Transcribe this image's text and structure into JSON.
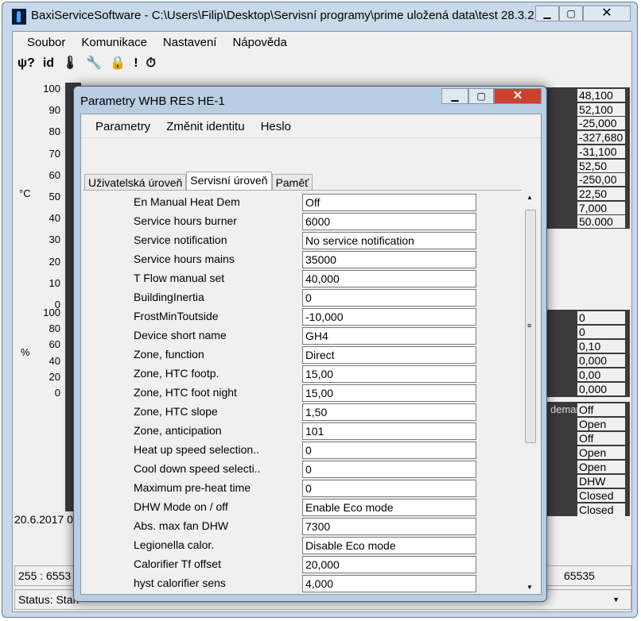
{
  "main": {
    "title": "BaxiServiceSoftware - C:\\Users\\Filip\\Desktop\\Servisní programy\\prime uložená data\\test 28.3.2...",
    "menu": [
      "Soubor",
      "Komunikace",
      "Nastavení",
      "Nápověda"
    ],
    "toolbar": [
      "ψ?",
      "id",
      "🌡",
      "🔧",
      "🔒",
      "!",
      "⏱"
    ],
    "temp_axis": {
      "unit": "°C",
      "ticks": [
        "100",
        "90",
        "80",
        "70",
        "60",
        "50",
        "40",
        "30",
        "20",
        "10",
        "0"
      ]
    },
    "pct_axis": {
      "unit": "%",
      "ticks": [
        "100",
        "80",
        "60",
        "40",
        "20",
        "0"
      ]
    },
    "date_fragment": "20.6.2017 0",
    "right_values_1": [
      "48,100",
      "52,100",
      "-25,000",
      "-327,680",
      "-31,100",
      "52,50",
      "-250,00",
      "22,50",
      "7,000",
      "50.000"
    ],
    "right_values_2": [
      "0",
      "0",
      "0,10",
      "0,000",
      "0,00",
      "0,000"
    ],
    "right_label_fragment": "demar",
    "right_values_3": [
      "Off",
      "Open",
      "Off",
      "Open",
      "Open",
      "DHW",
      "Closed",
      "Closed"
    ],
    "bottom_left": "255  :  6553",
    "bottom_right": "65535",
    "status": "Status: Stan"
  },
  "dialog": {
    "title": "Parametry WHB RES HE-1",
    "menu": [
      "Parametry",
      "Změnit identitu",
      "Heslo"
    ],
    "tabs": [
      "Uživatelská úroveň",
      "Servisní úroveň",
      "Paměť"
    ],
    "active_tab": 1,
    "rows": [
      {
        "label": "En Manual Heat Dem",
        "value": "Off"
      },
      {
        "label": "Service hours burner",
        "value": "6000"
      },
      {
        "label": "Service notification",
        "value": "No service notification"
      },
      {
        "label": "Service hours mains",
        "value": "35000"
      },
      {
        "label": "T Flow manual set",
        "value": "40,000"
      },
      {
        "label": "BuildingInertia",
        "value": "0"
      },
      {
        "label": "FrostMinToutside",
        "value": "-10,000"
      },
      {
        "label": "Device short name",
        "value": "GH4"
      },
      {
        "label": "Zone, function",
        "value": "Direct"
      },
      {
        "label": "Zone, HTC footp.",
        "value": "15,00"
      },
      {
        "label": "Zone, HTC foot night",
        "value": "15,00"
      },
      {
        "label": "Zone, HTC slope",
        "value": "1,50"
      },
      {
        "label": "Zone, anticipation",
        "value": "101"
      },
      {
        "label": "Heat up speed selection..",
        "value": "0"
      },
      {
        "label": "Cool down speed selecti..",
        "value": "0"
      },
      {
        "label": "Maximum pre-heat time",
        "value": "0"
      },
      {
        "label": "DHW Mode on / off",
        "value": "Enable Eco mode"
      },
      {
        "label": "Abs. max fan DHW",
        "value": "7300"
      },
      {
        "label": "Legionella calor.",
        "value": "Disable Eco mode"
      },
      {
        "label": "Calorifier Tf offset",
        "value": "20,000"
      },
      {
        "label": "hyst calorifier sens",
        "value": "4,000"
      }
    ]
  }
}
